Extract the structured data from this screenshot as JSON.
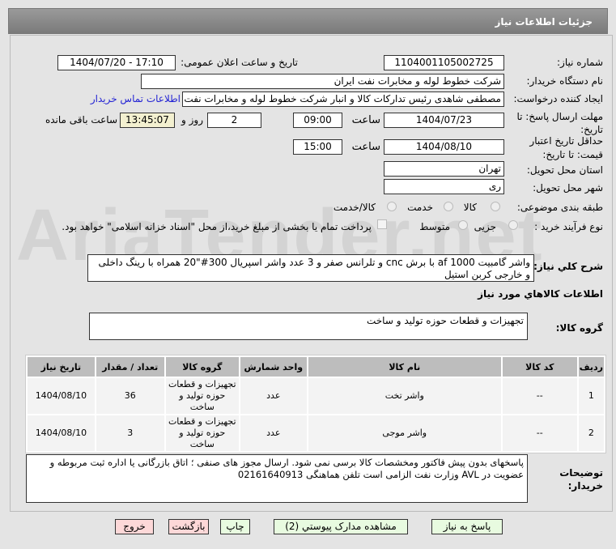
{
  "header": {
    "title": "جزئیات اطلاعات نیاز"
  },
  "fields": {
    "need_number_label": "شماره نیاز:",
    "need_number": "1104001105002725",
    "announce_label": "تاریخ و ساعت اعلان عمومی:",
    "announce_value": "1404/07/20 - 17:10",
    "buyer_label": "نام دستگاه خریدار:",
    "buyer_value": "شرکت خطوط لوله و مخابرات نفت ایران",
    "creator_label": "ایجاد کننده درخواست:",
    "creator_value": "مصطفی  شاهدی رئیس تدارکات کالا و انبار شرکت خطوط لوله و مخابرات نفت ایر",
    "contact_link": "اطلاعات تماس خریدار",
    "deadline_label": "مهلت ارسال پاسخ: تا تاریخ:",
    "deadline_date": "1404/07/23",
    "time_label": "ساعت",
    "deadline_time": "09:00",
    "days": "2",
    "days_label": "روز و",
    "remaining": "13:45:07",
    "remaining_label": "ساعت باقی مانده",
    "validity_label": "حداقل تاریخ اعتبار قیمت: تا تاریخ:",
    "validity_date": "1404/08/10",
    "validity_time": "15:00",
    "province_label": "استان محل تحویل:",
    "province": "تهران",
    "city_label": "شهر محل تحویل:",
    "city": "ری",
    "category_label": "طبقه بندی موضوعی:",
    "category_options": [
      "کالا",
      "خدمت",
      "کالا/خدمت"
    ],
    "process_label": "نوع فرآیند خرید :",
    "process_options": [
      "جزیی",
      "متوسط"
    ],
    "payment_note": "پرداخت تمام یا بخشی از مبلغ خرید،از محل \"اسناد خزانه اسلامی\" خواهد بود."
  },
  "description": {
    "label": "شرح کلي نیاز:",
    "value": "واشر گامبیت af 1000 با برش cnc و تلرانس صفر و 3 عدد واشر اسپریال 300#\"20 همراه با رینگ داخلی و خارجی کربن استیل"
  },
  "goods_title": "اطلاعات کالاهاي مورد نیاز",
  "goods_group": {
    "label": "گروه کالا:",
    "value": "تجهیزات و قطعات حوزه تولید و ساخت"
  },
  "table": {
    "headers": [
      "ردیف",
      "کد کالا",
      "نام کالا",
      "واحد شمارش",
      "گروه کالا",
      "تعداد / مقدار",
      "تاریخ نیاز"
    ],
    "rows": [
      [
        "1",
        "--",
        "واشر تخت",
        "عدد",
        "تجهیزات و قطعات حوزه تولید و ساخت",
        "36",
        "1404/08/10"
      ],
      [
        "2",
        "--",
        "واشر موجی",
        "عدد",
        "تجهیزات و قطعات حوزه تولید و ساخت",
        "3",
        "1404/08/10"
      ]
    ]
  },
  "remarks": {
    "label": "توضیحات خریدار:",
    "value": "پاسخهای بدون پیش فاکتور ومخشصات کالا برسی نمی شود. ارسال مجوز های صنفی ؛ اتاق بازرگانی یا اداره ثبت  مربوطه و عضویت در AVL وزارت نفت الزامی است تلفن هماهنگی  02161640913"
  },
  "buttons": {
    "reply": "پاسخ به نیاز",
    "docs": "مشاهده مدارک پیوستي (2)",
    "print": "چاپ",
    "back": "بازگشت",
    "exit": "خروج"
  },
  "watermark": "AriaTender.net"
}
